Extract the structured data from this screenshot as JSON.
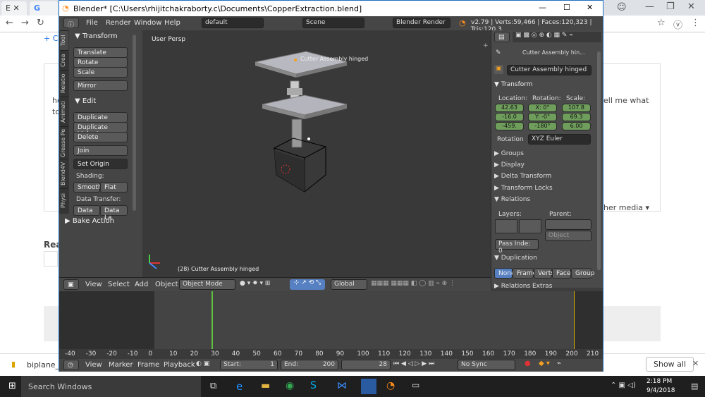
{
  "browser": {
    "tabs": [
      {
        "label": "E"
      },
      {
        "label": "G"
      }
    ],
    "webpage_texts": {
      "t1": "+ Ch",
      "t2": "he",
      "t3": "to",
      "t4": "ell me what",
      "t5": "Rea",
      "t6": "her media ▾"
    },
    "download": {
      "filename": "biplane_mo",
      "show_all": "Show all"
    }
  },
  "blender": {
    "title": "Blender* [C:\\Users\\rhijitchakraborty.c\\Documents\\CopperExtraction.blend]",
    "menu": [
      "File",
      "Render",
      "Window",
      "Help"
    ],
    "layout": "default",
    "scene": "Scene",
    "engine": "Blender Render",
    "stats": "v2.79 | Verts:59,466 | Faces:120,323 | Tris:120,3",
    "toolshelf": {
      "tabs": [
        "Tool",
        "Crea",
        "Relatio",
        "Animati",
        "Grease Pe",
        "Blend4V",
        "Physi"
      ],
      "transform_header": "Transform",
      "translate": "Translate",
      "rotate": "Rotate",
      "scale": "Scale",
      "mirror": "Mirror",
      "edit_header": "Edit",
      "duplicate": "Duplicate",
      "duplicate_linked": "Duplicate Linked",
      "delete": "Delete",
      "join": "Join",
      "set_origin": "Set Origin",
      "shading_label": "Shading:",
      "smooth": "Smooth",
      "flat": "Flat",
      "data_transfer_label": "Data Transfer:",
      "data": "Data",
      "data_la": "Data La",
      "bake_action": "Bake Action"
    },
    "viewport": {
      "view_label": "User Persp",
      "object_label": "Cutter Assembly hinged",
      "status": "(28) Cutter Assembly hinged"
    },
    "view3d_header": {
      "view": "View",
      "select": "Select",
      "add": "Add",
      "object": "Object",
      "mode": "Object Mode",
      "orientation": "Global"
    },
    "properties": {
      "context_object": "Cutter Assembly hin...",
      "object_name": "Cutter Assembly hinged",
      "transform_header": "Transform",
      "location_label": "Location:",
      "rotation_label": "Rotation:",
      "scale_label": "Scale:",
      "location": [
        "42.63",
        "-16.0",
        "-459."
      ],
      "rotation": [
        "X: 0°",
        "Y: -0°",
        "-180°"
      ],
      "scale": [
        "107.8",
        "69.3",
        "6.00"
      ],
      "rotation_mode_label": "Rotation",
      "rotation_mode": "XYZ Euler",
      "groups": "Groups",
      "display": "Display",
      "delta_transform": "Delta Transform",
      "transform_locks": "Transform Locks",
      "relations": "Relations",
      "layers_label": "Layers:",
      "parent_label": "Parent:",
      "parent_type": "Object",
      "pass_index": "Pass Inde: 0",
      "duplication": "Duplication",
      "dup_options": [
        "None",
        "Frames",
        "Verts",
        "Faces",
        "Group"
      ],
      "relations_extras": "Relations Extras"
    },
    "timeline": {
      "ruler": [
        "-40",
        "-30",
        "-20",
        "-10",
        "0",
        "10",
        "20",
        "30",
        "40",
        "50",
        "60",
        "70",
        "80",
        "90",
        "100",
        "110",
        "120",
        "130",
        "140",
        "150",
        "160",
        "170",
        "180",
        "190",
        "200",
        "210"
      ],
      "current_frame": 28,
      "view": "View",
      "marker": "Marker",
      "frame": "Frame",
      "playback": "Playback",
      "start_label": "Start:",
      "start": "1",
      "end_label": "End:",
      "end": "200",
      "frame_value": "28",
      "sync": "No Sync"
    }
  },
  "taskbar": {
    "search": "Search Windows",
    "time": "2:18 PM",
    "date": "9/4/2018"
  },
  "colors": {
    "accent": "#5680c2",
    "green": "#6f9e5c",
    "frame_line": "#60c040"
  }
}
